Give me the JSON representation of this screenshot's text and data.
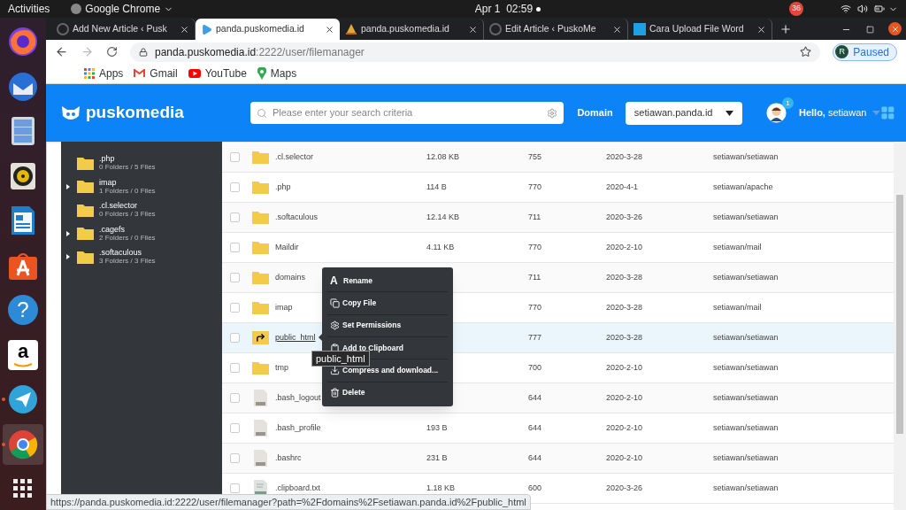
{
  "topbar": {
    "activities": "Activities",
    "app": "Google Chrome",
    "clock": "Apr 1  02:59",
    "notifications": "36"
  },
  "dock": [
    {
      "kind": "firefox",
      "running": false,
      "selected": false
    },
    {
      "kind": "mail",
      "running": false,
      "selected": false
    },
    {
      "kind": "files",
      "running": false,
      "selected": false
    },
    {
      "kind": "music",
      "running": false,
      "selected": false
    },
    {
      "kind": "writer",
      "running": false,
      "selected": false
    },
    {
      "kind": "store",
      "running": false,
      "selected": false
    },
    {
      "kind": "help",
      "glyph": "?",
      "running": false,
      "selected": false
    },
    {
      "kind": "amazon",
      "glyph": "a",
      "running": false,
      "selected": false
    },
    {
      "kind": "telegram",
      "running": true,
      "selected": false
    },
    {
      "kind": "chrome",
      "running": true,
      "selected": true
    },
    {
      "kind": "grid",
      "running": false,
      "selected": false
    }
  ],
  "tabs": [
    {
      "title": "Add New Article ‹ Pusk",
      "kind": "wp",
      "selected": false
    },
    {
      "title": "panda.puskomedia.id",
      "kind": "da",
      "selected": true
    },
    {
      "title": "panda.puskomedia.id",
      "kind": "sail",
      "selected": false
    },
    {
      "title": "Edit Article ‹ PuskoMe",
      "kind": "wp",
      "selected": false
    },
    {
      "title": "Cara Upload File Word",
      "kind": "dn",
      "selected": false
    }
  ],
  "toolbar": {
    "url_host": "panda.puskomedia.id",
    "url_rest": ":2222/user/filemanager",
    "profile_initial": "R",
    "profile_status": "Paused"
  },
  "bookmarks": [
    {
      "kind": "apps",
      "label": "Apps"
    },
    {
      "kind": "gmail",
      "label": "Gmail"
    },
    {
      "kind": "youtube",
      "label": "YouTube"
    },
    {
      "kind": "maps",
      "label": "Maps"
    }
  ],
  "header": {
    "logo": "puskomedia",
    "search_placeholder": "Please enter your search criteria",
    "domain_label": "Domain",
    "domain_value": "setiawan.panda.id",
    "badge": "1",
    "greeting": "**Hello,** setiawan"
  },
  "sidebar": {
    "items": [
      {
        "name": ".php",
        "count": "0 Folders / 5 Files",
        "expandable": false
      },
      {
        "name": "imap",
        "count": "1 Folders / 0 Files",
        "expandable": true
      },
      {
        "name": ".cl.selector",
        "count": "0 Folders / 3 Files",
        "expandable": false
      },
      {
        "name": ".cagefs",
        "count": "2 Folders / 0 Files",
        "expandable": true
      },
      {
        "name": ".softaculous",
        "count": "3 Folders / 3 Files",
        "expandable": true
      }
    ]
  },
  "table": {
    "rows": [
      {
        "kind": "folder",
        "name": ".cl.selector",
        "size": "12.08 KB",
        "perms": "755",
        "date": "2020-3-28",
        "owner": "setiawan/setiawan",
        "checked": false,
        "selected": false
      },
      {
        "kind": "folder",
        "name": ".php",
        "size": "114 B",
        "perms": "770",
        "date": "2020-4-1",
        "owner": "setiawan/apache",
        "checked": false,
        "selected": false
      },
      {
        "kind": "folder",
        "name": ".softaculous",
        "size": "12.14 KB",
        "perms": "711",
        "date": "2020-3-26",
        "owner": "setiawan/setiawan",
        "checked": false,
        "selected": false
      },
      {
        "kind": "folder",
        "name": "Maildir",
        "size": "4.11 KB",
        "perms": "770",
        "date": "2020-2-10",
        "owner": "setiawan/mail",
        "checked": false,
        "selected": false
      },
      {
        "kind": "folder",
        "name": "domains",
        "perms": "711",
        "date": "2020-3-28",
        "owner": "setiawan/setiawan",
        "checked": false,
        "selected": false
      },
      {
        "kind": "folder",
        "name": "imap",
        "perms": "770",
        "date": "2020-3-28",
        "owner": "setiawan/mail",
        "checked": false,
        "selected": false
      },
      {
        "kind": "link",
        "name": "public_html",
        "perms": "777",
        "date": "2020-3-28",
        "owner": "setiawan/setiawan",
        "checked": false,
        "selected": true
      },
      {
        "kind": "folder",
        "name": "tmp",
        "perms": "700",
        "date": "2020-2-10",
        "owner": "setiawan/setiawan",
        "checked": false,
        "selected": false
      },
      {
        "kind": "file",
        "name": ".bash_logout",
        "perms": "644",
        "date": "2020-2-10",
        "owner": "setiawan/setiawan",
        "checked": false,
        "selected": false
      },
      {
        "kind": "file",
        "name": ".bash_profile",
        "size": "193 B",
        "perms": "644",
        "date": "2020-2-10",
        "owner": "setiawan/setiawan",
        "checked": false,
        "selected": false
      },
      {
        "kind": "file",
        "name": ".bashrc",
        "size": "231 B",
        "perms": "644",
        "date": "2020-2-10",
        "owner": "setiawan/setiawan",
        "checked": false,
        "selected": false
      },
      {
        "kind": "text",
        "name": ".clipboard.txt",
        "size": "1.18 KB",
        "perms": "600",
        "date": "2020-3-26",
        "owner": "setiawan/setiawan",
        "checked": false,
        "selected": false
      }
    ]
  },
  "context_menu": {
    "items": [
      {
        "kind": "rename",
        "glyph": "A",
        "label": "Rename"
      },
      {
        "kind": "copy",
        "label": "Copy File"
      },
      {
        "kind": "permissions",
        "label": "Set Permissions"
      },
      {
        "kind": "clipboard",
        "label": "Add to Clipboard"
      },
      {
        "kind": "download",
        "label": "Compress and download..."
      },
      {
        "kind": "delete",
        "label": "Delete"
      }
    ]
  },
  "tooltip": "public_html",
  "status_url": "https://panda.puskomedia.id:2222/user/filemanager?path=%2Fdomains%2Fsetiawan.panda.id%2Fpublic_html"
}
